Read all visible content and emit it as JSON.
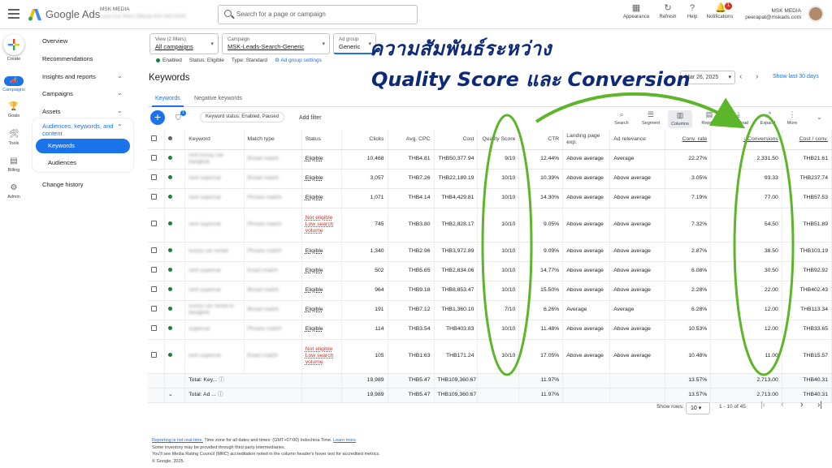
{
  "header": {
    "brand": "Google Ads",
    "account_name": "MSK MEDIA",
    "account_sub": "Luxe Car Rent Official",
    "account_id": "000-000-0000",
    "search_placeholder": "Search for a page or campaign",
    "tools": [
      {
        "label": "Appearance",
        "icon": "appearance-icon"
      },
      {
        "label": "Refresh",
        "icon": "refresh-icon"
      },
      {
        "label": "Help",
        "icon": "help-icon"
      },
      {
        "label": "Notifications",
        "icon": "bell-icon"
      }
    ],
    "notif_count": "1",
    "user_org": "MSK MEDIA",
    "user_email": "peerapat@mskads.com"
  },
  "rail": [
    {
      "label": "Create"
    },
    {
      "label": "Campaigns"
    },
    {
      "label": "Goals"
    },
    {
      "label": "Tools"
    },
    {
      "label": "Billing"
    },
    {
      "label": "Admin"
    }
  ],
  "nav": {
    "overview": "Overview",
    "recommendations": "Recommendations",
    "insights": "Insights and reports",
    "campaigns": "Campaigns",
    "assets": "Assets",
    "group_title": "Audiences, keywords, and content",
    "keywords": "Keywords",
    "audiences": "Audiences",
    "change_history": "Change history"
  },
  "filters": {
    "view_label": "View (2 filters)",
    "view_value": "All campaigns",
    "campaign_label": "Campaign",
    "campaign_value": "MSK-Leads-Search-Generic",
    "adgroup_label": "Ad group",
    "adgroup_value": "Generic"
  },
  "status": {
    "enabled": "Enabled",
    "status_text": "Status: Eligible",
    "type_text": "Type: Standard",
    "settings": "Ad group settings"
  },
  "page": {
    "title": "Keywords",
    "date": "Mar 26, 2025",
    "show_last": "Show last 30 days",
    "tabs": [
      "Keywords",
      "Negative keywords"
    ],
    "filter_count": "1",
    "chip": "Keyword status: Enabled, Paused",
    "add_filter": "Add filter"
  },
  "toolbar": [
    "Search",
    "Segment",
    "Columns",
    "Reports",
    "Download",
    "Expand",
    "More"
  ],
  "table": {
    "headers": [
      "Keyword",
      "Match type",
      "Status",
      "Clicks",
      "Avg. CPC",
      "Cost",
      "Quality Score",
      "CTR",
      "Landing page exp.",
      "Ad relevance",
      "Conv. rate",
      "Conversions",
      "Cost / conv."
    ],
    "rows": [
      {
        "kw": "rent luxury car bangkok",
        "match": "Broad match",
        "status": "Eligible",
        "clicks": "10,468",
        "cpc": "THB4.81",
        "cost": "THB50,377.94",
        "qs": "9/10",
        "ctr": "12.44%",
        "lp": "Above average",
        "ar": "Average",
        "cr": "22.27%",
        "conv": "2,331.50",
        "cpa": "THB21.61"
      },
      {
        "kw": "rent supercar",
        "match": "Broad match",
        "status": "Eligible",
        "clicks": "3,057",
        "cpc": "THB7.26",
        "cost": "THB22,189.19",
        "qs": "10/10",
        "ctr": "10.39%",
        "lp": "Above average",
        "ar": "Above average",
        "cr": "3.05%",
        "conv": "93.33",
        "cpa": "THB237.74"
      },
      {
        "kw": "rent supercar",
        "match": "Phrase match",
        "status": "Eligible",
        "clicks": "1,071",
        "cpc": "THB4.14",
        "cost": "THB4,429.81",
        "qs": "10/10",
        "ctr": "14.30%",
        "lp": "Above average",
        "ar": "Above average",
        "cr": "7.19%",
        "conv": "77.00",
        "cpa": "THB57.53"
      },
      {
        "kw": "rent supercar",
        "match": "Phrase match",
        "status": "Not eligible Low search volume",
        "clicks": "745",
        "cpc": "THB3.80",
        "cost": "THB2,828.17",
        "qs": "10/10",
        "ctr": "9.05%",
        "lp": "Above average",
        "ar": "Above average",
        "cr": "7.32%",
        "conv": "54.50",
        "cpa": "THB51.89"
      },
      {
        "kw": "luxury car rental",
        "match": "Phrase match",
        "status": "Eligible",
        "clicks": "1,340",
        "cpc": "THB2.96",
        "cost": "THB3,972.89",
        "qs": "10/10",
        "ctr": "9.09%",
        "lp": "Above average",
        "ar": "Above average",
        "cr": "2.87%",
        "conv": "38.50",
        "cpa": "THB103.19"
      },
      {
        "kw": "rent supercar",
        "match": "Exact match",
        "status": "Eligible",
        "clicks": "502",
        "cpc": "THB5.65",
        "cost": "THB2,834.06",
        "qs": "10/10",
        "ctr": "14.77%",
        "lp": "Above average",
        "ar": "Above average",
        "cr": "6.08%",
        "conv": "30.50",
        "cpa": "THB92.92"
      },
      {
        "kw": "rent supercar",
        "match": "Broad match",
        "status": "Eligible",
        "clicks": "964",
        "cpc": "THB9.18",
        "cost": "THB8,853.47",
        "qs": "10/10",
        "ctr": "15.50%",
        "lp": "Above average",
        "ar": "Above average",
        "cr": "2.28%",
        "conv": "22.00",
        "cpa": "THB402.43"
      },
      {
        "kw": "luxury car rental in bangkok",
        "match": "Broad match",
        "status": "Eligible",
        "clicks": "191",
        "cpc": "THB7.12",
        "cost": "THB1,360.10",
        "qs": "7/10",
        "ctr": "6.26%",
        "lp": "Average",
        "ar": "Average",
        "cr": "6.28%",
        "conv": "12.00",
        "cpa": "THB113.34"
      },
      {
        "kw": "supercar",
        "match": "Phrase match",
        "status": "Eligible",
        "clicks": "114",
        "cpc": "THB3.54",
        "cost": "THB403.83",
        "qs": "10/10",
        "ctr": "11.48%",
        "lp": "Above average",
        "ar": "Above average",
        "cr": "10.53%",
        "conv": "12.00",
        "cpa": "THB33.65"
      },
      {
        "kw": "rent supercar",
        "match": "Exact match",
        "status": "Not eligible Low search volume",
        "clicks": "105",
        "cpc": "THB1.63",
        "cost": "THB171.24",
        "qs": "10/10",
        "ctr": "17.05%",
        "lp": "Above average",
        "ar": "Above average",
        "cr": "10.48%",
        "conv": "11.00",
        "cpa": "THB15.57"
      }
    ],
    "totals": [
      {
        "label": "Total: Key...",
        "clicks": "19,989",
        "cpc": "THB5.47",
        "cost": "THB109,360.67",
        "ctr": "11.97%",
        "cr": "13.57%",
        "conv": "2,713.00",
        "cpa": "THB40.31"
      },
      {
        "label": "Total: Ad ...",
        "clicks": "19,989",
        "cpc": "THB5.47",
        "cost": "THB109,360.67",
        "ctr": "11.97%",
        "cr": "13.57%",
        "conv": "2,713.00",
        "cpa": "THB40.31"
      }
    ]
  },
  "pager": {
    "show_rows": "Show rows:",
    "rows": "10",
    "range": "1 - 10 of 45"
  },
  "footer": {
    "link1": "Reporting is not real-time.",
    "text1": " Time zone for all dates and times: (GMT+07:00) Indochina Time. ",
    "link2": "Learn more",
    "line2": "Some inventory may be provided through third party intermediaries.",
    "line3": "You'll see Media Rating Council (MRC) accreditation noted in the column header's hover text for accredited metrics.",
    "line4": "© Google, 2025."
  },
  "overlay": {
    "thai": "ความสัมพันธ์ระหว่าง",
    "english": "Quality Score และ Conversion",
    "highlight_color": "#5db52a",
    "text_color": "#0d2a78"
  }
}
